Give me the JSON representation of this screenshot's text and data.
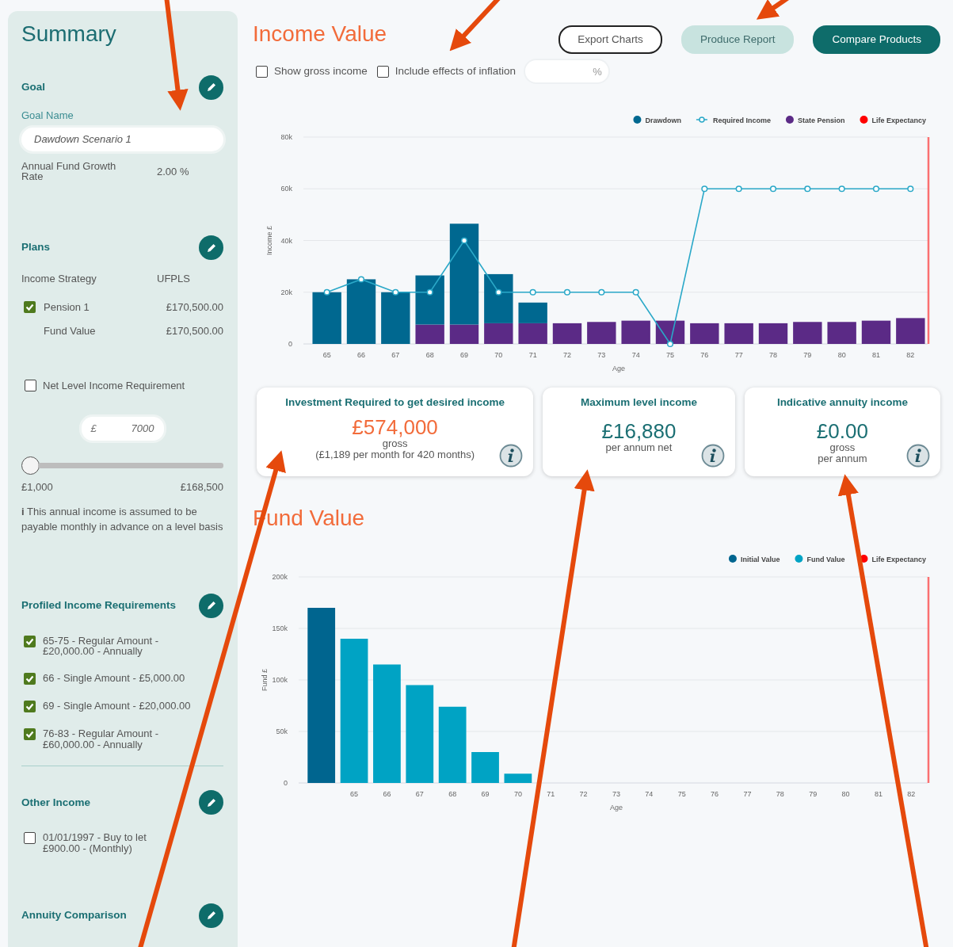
{
  "summary": {
    "title": "Summary",
    "goal": {
      "heading": "Goal",
      "name_label": "Goal Name",
      "name_value": "Dawdown Scenario 1",
      "growth_label": "Annual Fund Growth Rate",
      "growth_value": "2.00 %"
    },
    "plans": {
      "heading": "Plans",
      "strategy_label": "Income Strategy",
      "strategy_value": "UFPLS",
      "pensions": [
        {
          "name": "Pension 1",
          "amount": "£170,500.00",
          "checked": true,
          "fund_label": "Fund Value",
          "fund_value": "£170,500.00"
        }
      ]
    },
    "net_level": {
      "label": "Net Level Income Requirement",
      "checked": false
    },
    "income_input": {
      "prefix": "£",
      "value": "7000"
    },
    "slider": {
      "level": 0,
      "min_label": "£1,000",
      "max_label": "£168,500"
    },
    "note": {
      "text": "**i** This annual income is assumed to be payable monthly in advance on a level basis"
    },
    "profiled": {
      "heading": "Profiled Income Requirements",
      "items": [
        {
          "text": "65-75 - Regular Amount - £20,000.00 - Annually",
          "checked": true
        },
        {
          "text": "66 - Single Amount - £5,000.00",
          "checked": true
        },
        {
          "text": "69 - Single Amount - £20,000.00",
          "checked": true
        },
        {
          "text": "76-83 - Regular Amount - £60,000.00 - Annually",
          "checked": true
        }
      ]
    },
    "other_income": {
      "heading": "Other Income",
      "items": [
        {
          "text": "01/01/1997 - Buy to let £900.00 - (Monthly)",
          "checked": false
        }
      ]
    },
    "annuity": {
      "heading": "Annuity Comparison"
    }
  },
  "income_value": {
    "title": "Income Value",
    "buttons": [
      {
        "label": "Export Charts",
        "kind": "outline"
      },
      {
        "label": "Produce Report",
        "kind": "light"
      },
      {
        "label": "Compare Products",
        "kind": "dark"
      }
    ],
    "options": [
      {
        "label": "Show gross income",
        "checked": false
      },
      {
        "label": "Include effects of inflation",
        "checked": false
      }
    ],
    "inflation_field": {
      "suffix": "%"
    },
    "chart_data": {
      "type": "bar",
      "xlabel": "Age",
      "ylabel": "Income £",
      "stacked": true,
      "grid": true,
      "legend": "top-right",
      "categories": [
        "65",
        "66",
        "67",
        "68",
        "69",
        "70",
        "71",
        "72",
        "73",
        "74",
        "75",
        "76",
        "77",
        "78",
        "79",
        "80",
        "81",
        "82"
      ],
      "ylim": [
        0,
        80000
      ],
      "yticks": [
        {
          "value": 0,
          "label": "0"
        },
        {
          "value": 20000,
          "label": "20k"
        },
        {
          "value": 40000,
          "label": "40k"
        },
        {
          "value": 60000,
          "label": "60k"
        },
        {
          "value": 80000,
          "label": "80k"
        }
      ],
      "series": [
        {
          "name": "Drawdown",
          "type": "bar",
          "color": "#006890",
          "values": [
            20000,
            25000,
            20000,
            19000,
            39000,
            19000,
            8000,
            null,
            null,
            null,
            null,
            null,
            null,
            null,
            null,
            null,
            null,
            null
          ]
        },
        {
          "name": "Required Income",
          "type": "line",
          "marker": "circle",
          "color": "#2aa8c8",
          "values": [
            20000,
            25000,
            20000,
            20000,
            40000,
            20000,
            20000,
            20000,
            20000,
            20000,
            0,
            60000,
            60000,
            60000,
            60000,
            60000,
            60000,
            60000
          ]
        },
        {
          "name": "State Pension",
          "type": "bar",
          "color": "#5b2a86",
          "values": [
            null,
            null,
            null,
            7500,
            7500,
            8000,
            8000,
            8000,
            8500,
            9000,
            9000,
            8000,
            8000,
            8000,
            8500,
            8500,
            9000,
            10000
          ]
        }
      ],
      "ref_lines": [
        {
          "axis": "x",
          "label": "Life Expectancy",
          "color": "#ff0000"
        }
      ]
    }
  },
  "result_cards": [
    {
      "title": "Investment Required to get desired income",
      "value": "£574,000",
      "kind": "highlight",
      "lines": [
        "gross",
        "(£1,189 per month for 420 months)"
      ]
    },
    {
      "title": "Maximum level income",
      "value": "£16,880",
      "kind": "normal",
      "lines": [
        "per annum net"
      ]
    },
    {
      "title": "Indicative annuity income",
      "value": "£0.00",
      "kind": "normal",
      "lines": [
        "gross",
        "per annum"
      ]
    }
  ],
  "fund_value": {
    "title": "Fund Value",
    "chart_data": {
      "type": "bar",
      "xlabel": "Age",
      "ylabel": "Fund £",
      "stacked": true,
      "grid": true,
      "legend": "top-right",
      "categories": [
        null,
        "65",
        "66",
        "67",
        "68",
        "69",
        "70",
        "71",
        "72",
        "73",
        "74",
        "75",
        "76",
        "77",
        "78",
        "79",
        "80",
        "81",
        "82"
      ],
      "ylim": [
        0,
        200000
      ],
      "yticks": [
        {
          "value": 0,
          "label": "0"
        },
        {
          "value": 50000,
          "label": "50k"
        },
        {
          "value": 100000,
          "label": "100k"
        },
        {
          "value": 150000,
          "label": "150k"
        },
        {
          "value": 200000,
          "label": "200k"
        }
      ],
      "series": [
        {
          "name": "Initial Value",
          "type": "bar",
          "color": "#00658f",
          "values": [
            170000,
            null,
            null,
            null,
            null,
            null,
            null,
            null,
            null,
            null,
            null,
            null,
            null,
            null,
            null,
            null,
            null,
            null,
            null
          ]
        },
        {
          "name": "Fund Value",
          "type": "bar",
          "color": "#00a3c4",
          "values": [
            null,
            140000,
            115000,
            95000,
            74000,
            30000,
            9000,
            null,
            null,
            null,
            null,
            null,
            null,
            null,
            null,
            null,
            null,
            null,
            null
          ]
        }
      ],
      "ref_lines": [
        {
          "axis": "x",
          "label": "Life Expectancy",
          "color": "#ff0000"
        }
      ]
    }
  }
}
